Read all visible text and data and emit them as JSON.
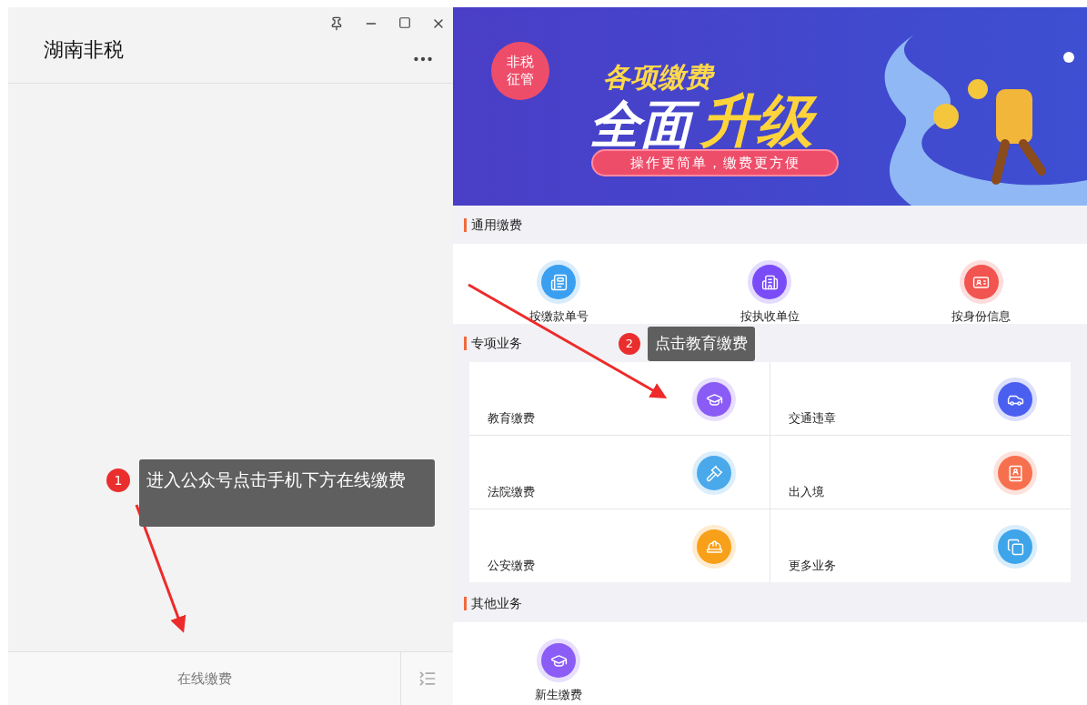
{
  "window": {
    "title": "湖南非税"
  },
  "bottom_menu": {
    "label": "在线缴费"
  },
  "banner": {
    "badge": [
      "非税",
      "征管"
    ],
    "headline_top": "各项缴费",
    "headline": [
      "全面",
      "升级"
    ],
    "slogan": "操作更简单，缴费更方便"
  },
  "sections": [
    {
      "title": "通用缴费",
      "kind": "icons",
      "items": [
        {
          "label": "按缴款单号",
          "kind": "receipt",
          "color": "#3a9ff0"
        },
        {
          "label": "按执收单位",
          "kind": "building",
          "color": "#7a4cf8"
        },
        {
          "label": "按身份信息",
          "kind": "id-card",
          "color": "#f25450"
        }
      ]
    },
    {
      "title": "专项业务",
      "kind": "tiles",
      "items": [
        {
          "label": "教育缴费",
          "kind": "graduation",
          "color": "#8a5cf5"
        },
        {
          "label": "交通违章",
          "kind": "car",
          "color": "#4a5ff0"
        },
        {
          "label": "法院缴费",
          "kind": "gavel",
          "color": "#4aa9ea"
        },
        {
          "label": "出入境",
          "kind": "passport",
          "color": "#f7704e"
        },
        {
          "label": "公安缴费",
          "kind": "police-cap",
          "color": "#f8a01a"
        },
        {
          "label": "更多业务",
          "kind": "more",
          "color": "#3fa5ea"
        }
      ]
    },
    {
      "title": "其他业务",
      "kind": "icons",
      "items": [
        {
          "label": "新生缴费",
          "kind": "graduation",
          "color": "#8b5cf6"
        }
      ]
    }
  ],
  "annotations": [
    {
      "number": "1",
      "text": "进入公众号点击手机下方在线缴费"
    },
    {
      "number": "2",
      "text": "点击教育缴费"
    }
  ]
}
